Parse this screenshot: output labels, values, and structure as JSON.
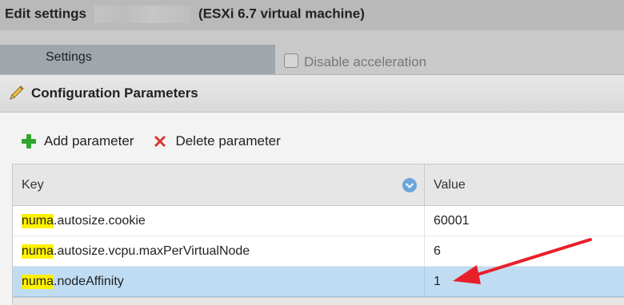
{
  "background_window": {
    "title": "Edit settings",
    "title_suffix": "(ESXi 6.7 virtual machine)",
    "settings_tab": "Settings",
    "disable_acceleration_label": "Disable acceleration"
  },
  "dialog": {
    "title": "Configuration Parameters",
    "title_icon": "pencil-icon",
    "toolbar": {
      "add_label": "Add parameter",
      "add_icon": "green-plus-icon",
      "delete_label": "Delete parameter",
      "delete_icon": "red-x-icon"
    },
    "grid": {
      "columns": {
        "key": "Key",
        "value": "Value"
      },
      "rows": [
        {
          "key_highlight": "numa",
          "key_rest": ".autosize.cookie",
          "value": "60001",
          "selected": false
        },
        {
          "key_highlight": "numa",
          "key_rest": ".autosize.vcpu.maxPerVirtualNode",
          "value": "6",
          "selected": false
        },
        {
          "key_highlight": "numa",
          "key_rest": ".nodeAffinity",
          "value": "1",
          "selected": true
        }
      ]
    }
  },
  "colors": {
    "highlight": "#fff200",
    "selected_row": "#bfdcf3",
    "arrow": "#e8202a"
  }
}
